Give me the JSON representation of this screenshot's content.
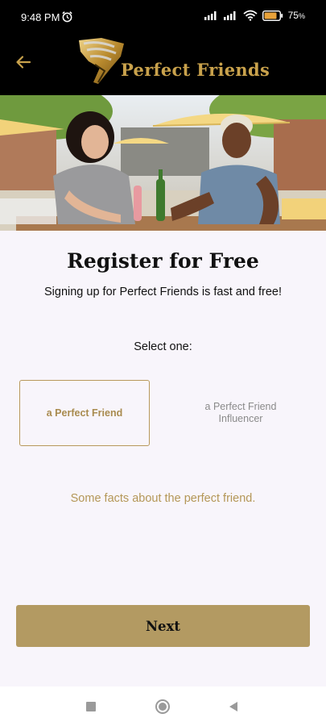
{
  "status_bar": {
    "time": "9:48 PM",
    "battery_percent": "75",
    "battery_suffix": "%"
  },
  "header": {
    "logo_text": "Perfect Friends"
  },
  "main": {
    "title": "Register for Free",
    "subtitle": "Signing up for Perfect Friends is fast and free!",
    "select_label": "Select one:",
    "options": [
      {
        "label": "a Perfect Friend",
        "selected": true
      },
      {
        "label": "a Perfect Friend Influencer",
        "selected": false
      }
    ],
    "facts_text": "Some facts about the perfect friend.",
    "next_label": "Next"
  },
  "colors": {
    "accent": "#b39a62",
    "accent_text": "#b49757",
    "header_bg": "#000000",
    "page_bg": "#f8f5fb"
  },
  "icons": {
    "back": "arrow-left-icon",
    "alarm": "alarm-icon",
    "signal": "signal-icon",
    "wifi": "wifi-icon",
    "battery": "battery-icon",
    "nav_recent": "square-icon",
    "nav_home": "circle-icon",
    "nav_back": "triangle-back-icon"
  }
}
